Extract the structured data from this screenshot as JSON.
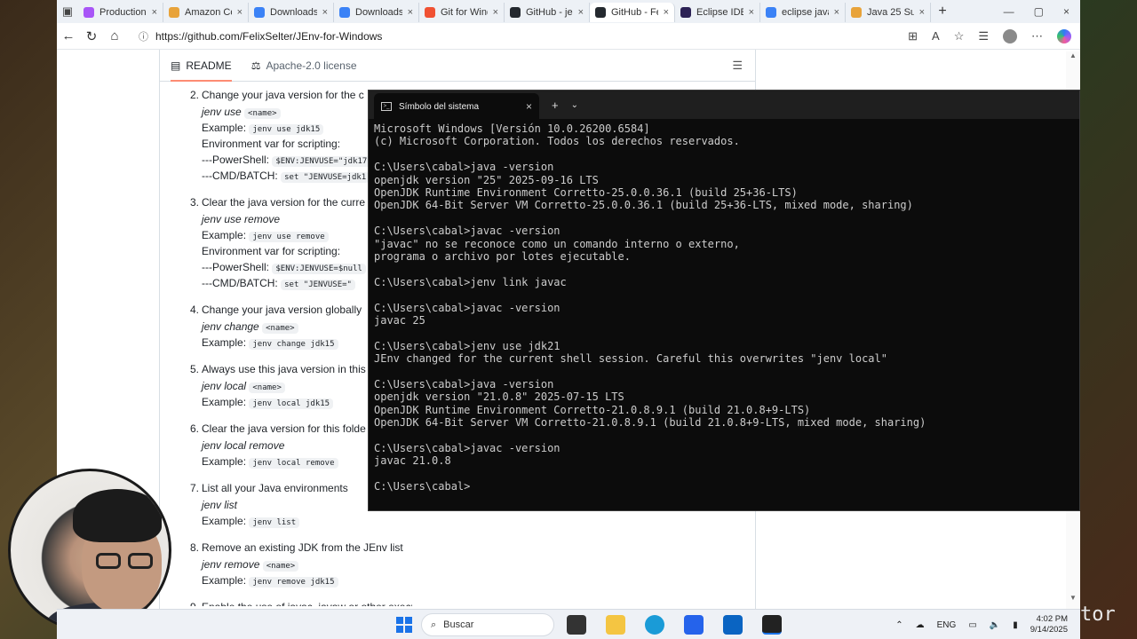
{
  "tabs": [
    {
      "label": "Production-",
      "color": "#a855f7"
    },
    {
      "label": "Amazon Co",
      "color": "#e8a33a"
    },
    {
      "label": "Downloads",
      "color": "#3b82f6"
    },
    {
      "label": "Downloads",
      "color": "#3b82f6"
    },
    {
      "label": "Git for Wind",
      "color": "#f05133"
    },
    {
      "label": "GitHub - jen",
      "color": "#24292f"
    },
    {
      "label": "GitHub - Fel",
      "color": "#24292f"
    },
    {
      "label": "Eclipse IDE |",
      "color": "#2c2255"
    },
    {
      "label": "eclipse java",
      "color": "#3b82f6"
    },
    {
      "label": "Java 25 Sup",
      "color": "#e8a33a"
    }
  ],
  "close_glyph": "×",
  "newtab_glyph": "+",
  "address": {
    "url": "https://github.com/FelixSelter/JEnv-for-Windows"
  },
  "readme": {
    "tab_label": "README",
    "license_label": "Apache-2.0 license"
  },
  "steps": [
    {
      "num": "2.",
      "title": "Change your java version for the c",
      "cmd_em": "jenv use",
      "cmd_arg": "<name>",
      "example_label": "Example:",
      "example": "jenv use jdk15",
      "env_label": "Environment var for scripting:",
      "ps_label": "---PowerShell:",
      "ps_code": "$ENV:JENVUSE=\"jdk17",
      "cmd_label": "---CMD/BATCH:",
      "cmd_code": "set \"JENVUSE=jdk1"
    },
    {
      "num": "3.",
      "title": "Clear the java version for the curre",
      "cmd_em": "jenv use remove",
      "cmd_arg": "",
      "example_label": "Example:",
      "example": "jenv use remove",
      "env_label": "Environment var for scripting:",
      "ps_label": "---PowerShell:",
      "ps_code": "$ENV:JENVUSE=$null",
      "cmd_label": "---CMD/BATCH:",
      "cmd_code": "set \"JENVUSE=\""
    },
    {
      "num": "4.",
      "title": "Change your java version globally",
      "cmd_em": "jenv change",
      "cmd_arg": "<name>",
      "example_label": "Example:",
      "example": "jenv change jdk15"
    },
    {
      "num": "5.",
      "title": "Always use this java version in this",
      "cmd_em": "jenv local",
      "cmd_arg": "<name>",
      "example_label": "Example:",
      "example": "jenv local jdk15"
    },
    {
      "num": "6.",
      "title": "Clear the java version for this folde",
      "cmd_em": "jenv local remove",
      "cmd_arg": "",
      "example_label": "Example:",
      "example": "jenv local remove"
    },
    {
      "num": "7.",
      "title": "List all your Java environments",
      "cmd_em": "jenv list",
      "cmd_arg": "",
      "example_label": "Example:",
      "example": "jenv list"
    },
    {
      "num": "8.",
      "title": "Remove an existing JDK from the JEnv list",
      "cmd_em": "jenv remove",
      "cmd_arg": "<name>",
      "example_label": "Example:",
      "example": "jenv remove jdk15"
    },
    {
      "num": "9.",
      "title": "Enable the use of javac, javaw or other executables sitting in the java directory"
    }
  ],
  "terminal": {
    "tab_title": "Símbolo del sistema",
    "lines": [
      "Microsoft Windows [Versión 10.0.26200.6584]",
      "(c) Microsoft Corporation. Todos los derechos reservados.",
      "",
      "C:\\Users\\cabal>java -version",
      "openjdk version \"25\" 2025-09-16 LTS",
      "OpenJDK Runtime Environment Corretto-25.0.0.36.1 (build 25+36-LTS)",
      "OpenJDK 64-Bit Server VM Corretto-25.0.0.36.1 (build 25+36-LTS, mixed mode, sharing)",
      "",
      "C:\\Users\\cabal>javac -version",
      "\"javac\" no se reconoce como un comando interno o externo,",
      "programa o archivo por lotes ejecutable.",
      "",
      "C:\\Users\\cabal>jenv link javac",
      "",
      "C:\\Users\\cabal>javac -version",
      "javac 25",
      "",
      "C:\\Users\\cabal>jenv use jdk21",
      "JEnv changed for the current shell session. Careful this overwrites \"jenv local\"",
      "",
      "C:\\Users\\cabal>java -version",
      "openjdk version \"21.0.8\" 2025-07-15 LTS",
      "OpenJDK Runtime Environment Corretto-21.0.8.9.1 (build 21.0.8+9-LTS)",
      "OpenJDK 64-Bit Server VM Corretto-21.0.8.9.1 (build 21.0.8+9-LTS, mixed mode, sharing)",
      "",
      "C:\\Users\\cabal>javac -version",
      "javac 21.0.8",
      "",
      "C:\\Users\\cabal>"
    ]
  },
  "taskbar": {
    "search_placeholder": "Buscar",
    "lang": "ENG",
    "time": "4:02 PM",
    "date": "9/14/2025"
  },
  "edge_text": "tor"
}
